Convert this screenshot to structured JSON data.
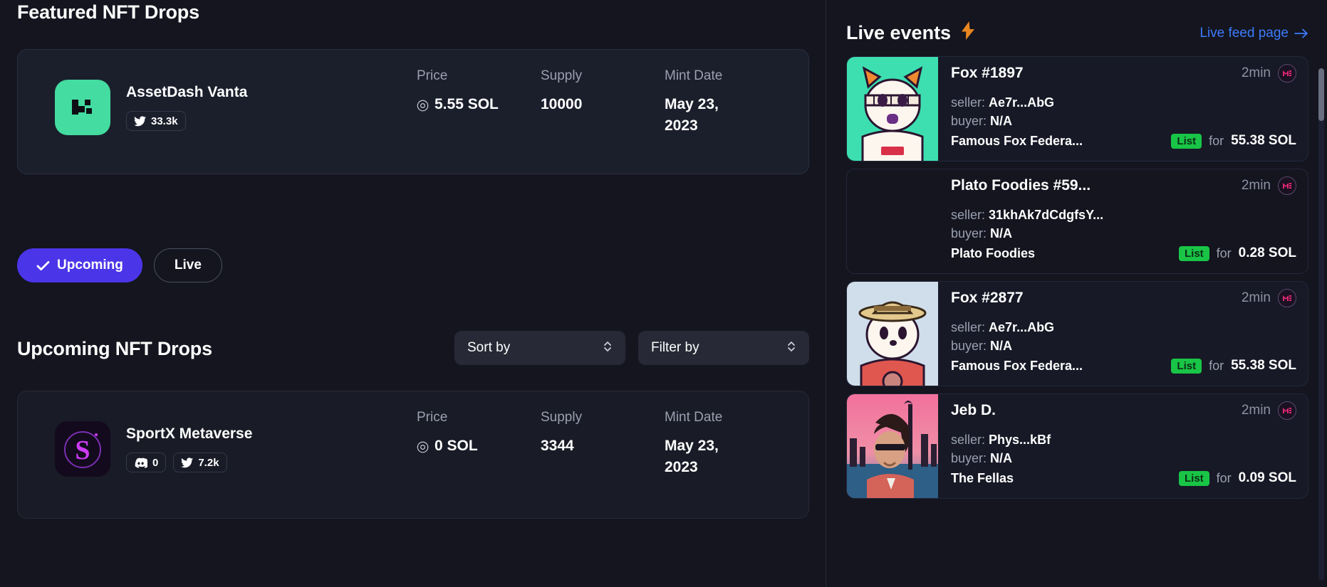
{
  "colors": {
    "page_bg": "#14151f",
    "card_bg": "#1b1f2c",
    "accent_purple": "#4b35e8",
    "link_blue": "#3d7bfb",
    "list_green": "#19c546",
    "vanta_green": "#44dca0",
    "muted_text": "#9aa0b0"
  },
  "left": {
    "featured_title": "Featured NFT Drops",
    "featured_card": {
      "logo_icon": "checkered-flag-icon",
      "name": "AssetDash Vanta",
      "badges": [
        {
          "icon": "twitter-icon",
          "value": "33.3k"
        }
      ],
      "stats": [
        {
          "label": "Price",
          "value": "5.55 SOL",
          "icon": "solana-icon"
        },
        {
          "label": "Supply",
          "value": "10000"
        },
        {
          "label": "Mint Date",
          "value": "May 23, 2023"
        }
      ]
    },
    "toggles": [
      {
        "label": "Upcoming",
        "icon": "check-icon",
        "active": true
      },
      {
        "label": "Live",
        "active": false
      }
    ],
    "upcoming_title": "Upcoming NFT Drops",
    "selects": [
      {
        "label": "Sort by",
        "icon": "chevron-updown-icon"
      },
      {
        "label": "Filter by",
        "icon": "chevron-updown-icon"
      }
    ],
    "upcoming_card": {
      "logo_icon": "sportx-s-icon",
      "name": "SportX Metaverse",
      "badges": [
        {
          "icon": "discord-icon",
          "value": "0"
        },
        {
          "icon": "twitter-icon",
          "value": "7.2k"
        }
      ],
      "stats": [
        {
          "label": "Price",
          "value": "0 SOL",
          "icon": "solana-icon"
        },
        {
          "label": "Supply",
          "value": "3344"
        },
        {
          "label": "Mint Date",
          "value": "May 23, 2023"
        }
      ]
    }
  },
  "right": {
    "title": "Live events",
    "title_icon": "lightning-bolt-icon",
    "feed_link": "Live feed page",
    "feed_link_icon": "arrow-right-icon",
    "labels": {
      "seller": "seller:",
      "buyer": "buyer:",
      "for": "for"
    },
    "events": [
      {
        "thumb": "fox-1897-avatar",
        "name": "Fox #1897",
        "time": "2min",
        "marketplace_icon": "magic-eden-icon",
        "seller": "Ae7r...AbG",
        "buyer": "N/A",
        "collection": "Famous Fox Federa...",
        "action": "List",
        "amount": "55.38 SOL"
      },
      {
        "thumb": "",
        "name": "Plato Foodies #59...",
        "time": "2min",
        "marketplace_icon": "magic-eden-icon",
        "seller": "31khAk7dCdgfsY...",
        "buyer": "N/A",
        "collection": "Plato Foodies",
        "action": "List",
        "amount": "0.28 SOL"
      },
      {
        "thumb": "fox-2877-avatar",
        "name": "Fox #2877",
        "time": "2min",
        "marketplace_icon": "magic-eden-icon",
        "seller": "Ae7r...AbG",
        "buyer": "N/A",
        "collection": "Famous Fox Federa...",
        "action": "List",
        "amount": "55.38 SOL"
      },
      {
        "thumb": "jeb-d-avatar",
        "name": "Jeb D.",
        "time": "2min",
        "marketplace_icon": "magic-eden-icon",
        "seller": "Phys...kBf",
        "buyer": "N/A",
        "collection": "The Fellas",
        "action": "List",
        "amount": "0.09 SOL"
      }
    ]
  }
}
